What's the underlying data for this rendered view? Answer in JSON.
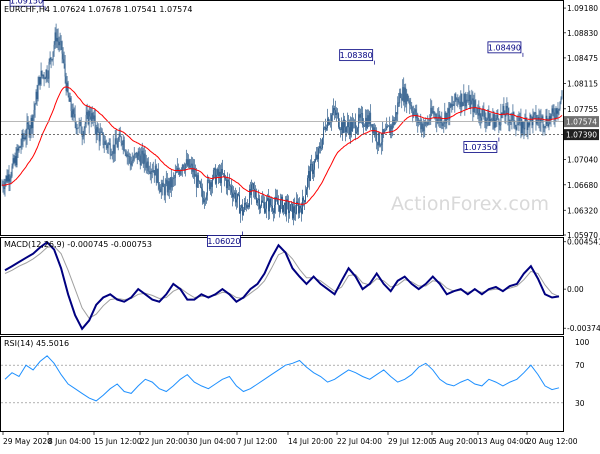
{
  "chart_data": [
    {
      "type": "candlestick",
      "symbol_header": "EURCHF,H4  1.07624 1.07678 1.07541 1.07574",
      "ylim": [
        1.0597,
        1.0928
      ],
      "x_tick_labels": [
        "29 May 2020",
        "8 Jun 04:00",
        "15 Jun 12:00",
        "22 Jun 20:00",
        "30 Jun 04:00",
        "7 Jul 12:00",
        "14 Jul 20:00",
        "22 Jul 04:00",
        "29 Jul 12:00",
        "5 Aug 20:00",
        "13 Aug 04:00",
        "20 Aug 12:00"
      ],
      "y_tick_labels": [
        "1.09180",
        "1.08830",
        "1.08475",
        "1.08115",
        "1.07755",
        "1.07395",
        "1.07040",
        "1.06680",
        "1.06320",
        "1.05970"
      ],
      "anchors": [
        [
          0,
          1.0668
        ],
        [
          5,
          1.069
        ],
        [
          10,
          1.073
        ],
        [
          15,
          1.076
        ],
        [
          19,
          1.082
        ],
        [
          23,
          1.083
        ],
        [
          27,
          1.088
        ],
        [
          30,
          1.0855
        ],
        [
          33,
          1.079
        ],
        [
          36,
          1.076
        ],
        [
          40,
          1.0745
        ],
        [
          44,
          1.077
        ],
        [
          48,
          1.074
        ],
        [
          52,
          1.0725
        ],
        [
          56,
          1.072
        ],
        [
          60,
          1.0735
        ],
        [
          64,
          1.07
        ],
        [
          68,
          1.071
        ],
        [
          72,
          1.07
        ],
        [
          76,
          1.069
        ],
        [
          80,
          1.066
        ],
        [
          85,
          1.067
        ],
        [
          90,
          1.07
        ],
        [
          95,
          1.069
        ],
        [
          100,
          1.065
        ],
        [
          105,
          1.068
        ],
        [
          110,
          1.068
        ],
        [
          115,
          1.066
        ],
        [
          120,
          1.063
        ],
        [
          125,
          1.066
        ],
        [
          130,
          1.064
        ],
        [
          135,
          1.064
        ],
        [
          140,
          1.064
        ],
        [
          145,
          1.063
        ],
        [
          150,
          1.064
        ],
        [
          153,
          1.068
        ],
        [
          158,
          1.071
        ],
        [
          162,
          1.076
        ],
        [
          166,
          1.077
        ],
        [
          170,
          1.075
        ],
        [
          175,
          1.075
        ],
        [
          180,
          1.076
        ],
        [
          184,
          1.076
        ],
        [
          188,
          1.073
        ],
        [
          192,
          1.074
        ],
        [
          196,
          1.076
        ],
        [
          199,
          1.08
        ],
        [
          203,
          1.079
        ],
        [
          207,
          1.076
        ],
        [
          211,
          1.075
        ],
        [
          215,
          1.077
        ],
        [
          219,
          1.076
        ],
        [
          223,
          1.077
        ],
        [
          227,
          1.079
        ],
        [
          231,
          1.079
        ],
        [
          235,
          1.078
        ],
        [
          239,
          1.077
        ],
        [
          243,
          1.076
        ],
        [
          247,
          1.076
        ],
        [
          251,
          1.077
        ],
        [
          255,
          1.076
        ],
        [
          259,
          1.075
        ],
        [
          263,
          1.076
        ],
        [
          267,
          1.076
        ],
        [
          271,
          1.076
        ],
        [
          275,
          1.0765
        ],
        [
          279,
          1.079
        ],
        [
          281,
          1.0815
        ],
        [
          284,
          1.077
        ],
        [
          287,
          1.076
        ],
        [
          290,
          1.0755
        ],
        [
          294,
          1.0757
        ]
      ],
      "price_labels": [
        {
          "text": "1.09150",
          "bar": 43,
          "price": 1.0915
        },
        {
          "text": "1.06020",
          "bar": 240,
          "price": 1.0602
        },
        {
          "text": "1.08380",
          "bar": 372,
          "price": 1.0838
        },
        {
          "text": "1.07350",
          "bar": 496,
          "price": 1.0735
        },
        {
          "text": "1.08490",
          "bar": 520,
          "price": 1.0849
        }
      ],
      "current_price": "1.07574",
      "level_price": "1.07390",
      "ma_color": "#ff0000",
      "candle_color": "#2c5b8a",
      "watermark": "ActionForex.com"
    },
    {
      "type": "line",
      "title": "MACD(12,26,9) -0.000745 -0.000753",
      "y_tick_labels": [
        "0.004541",
        "0.00",
        "-0.003745"
      ],
      "ylim": [
        -0.0043,
        0.0049
      ],
      "series": [
        {
          "values": [
            0.0018,
            0.0022,
            0.0026,
            0.003,
            0.0034,
            0.004,
            0.0045,
            0.0038,
            0.002,
            -0.0005,
            -0.0025,
            -0.0038,
            -0.003,
            -0.0015,
            -0.0008,
            -0.0005,
            -0.001,
            -0.0012,
            -0.0008,
            0.0,
            -0.0005,
            -0.001,
            -0.0012,
            -0.0005,
            0.0005,
            0.0,
            -0.001,
            -0.001,
            -0.0005,
            -0.0008,
            -0.0005,
            0.0,
            -0.0005,
            -0.0012,
            -0.0008,
            0.0,
            0.0005,
            0.0015,
            0.003,
            0.0042,
            0.0035,
            0.002,
            0.0012,
            0.0005,
            0.0012,
            0.0005,
            0.0,
            -0.0005,
            0.0008,
            0.002,
            0.0012,
            0.0,
            0.0005,
            0.0015,
            0.0005,
            -0.0002,
            0.0008,
            0.0012,
            0.0005,
            0.0,
            0.0005,
            0.0012,
            0.0005,
            -0.0005,
            -0.0002,
            0.0,
            -0.0005,
            0.0,
            -0.0005,
            0.0,
            0.0002,
            -0.0002,
            0.0003,
            0.0005,
            0.0015,
            0.0022,
            0.001,
            -0.0005,
            -0.0008,
            -0.0007
          ]
        },
        {
          "values": [
            0.0015,
            0.0018,
            0.0022,
            0.0025,
            0.0029,
            0.0034,
            0.004,
            0.0041,
            0.0034,
            0.0018,
            0.0,
            -0.0018,
            -0.0028,
            -0.0024,
            -0.0016,
            -0.001,
            -0.0009,
            -0.001,
            -0.0009,
            -0.0005,
            -0.0004,
            -0.0006,
            -0.0009,
            -0.0008,
            -0.0002,
            0.0001,
            -0.0004,
            -0.0008,
            -0.0007,
            -0.0007,
            -0.0006,
            -0.0003,
            -0.0004,
            -0.0008,
            -0.0009,
            -0.0004,
            0.0001,
            0.0008,
            0.002,
            0.0033,
            0.0036,
            0.0029,
            0.0019,
            0.0011,
            0.0011,
            0.0008,
            0.0003,
            -0.0002,
            0.0002,
            0.0013,
            0.0014,
            0.0006,
            0.0004,
            0.001,
            0.0008,
            0.0002,
            0.0004,
            0.0009,
            0.0007,
            0.0003,
            0.0003,
            0.0008,
            0.0007,
            0.0001,
            -0.0002,
            -0.0001,
            -0.0003,
            -0.0001,
            -0.0003,
            -0.0001,
            0.0,
            -0.0001,
            0.0001,
            0.0003,
            0.0009,
            0.0017,
            0.0015,
            0.0004,
            -0.0004,
            -0.0007
          ]
        }
      ]
    },
    {
      "type": "line",
      "title": "RSI(14) 45.5016",
      "y_tick_labels": [
        "100",
        "70",
        "30",
        "0"
      ],
      "ylim": [
        0,
        100
      ],
      "levels": [
        70,
        30
      ],
      "series": [
        {
          "values": [
            55,
            62,
            58,
            70,
            65,
            74,
            80,
            72,
            60,
            50,
            45,
            40,
            35,
            32,
            38,
            45,
            50,
            42,
            40,
            48,
            55,
            52,
            45,
            42,
            48,
            55,
            60,
            52,
            48,
            45,
            50,
            55,
            58,
            48,
            42,
            45,
            50,
            55,
            60,
            65,
            70,
            72,
            75,
            68,
            62,
            58,
            52,
            55,
            60,
            65,
            62,
            58,
            55,
            60,
            65,
            58,
            52,
            55,
            60,
            68,
            72,
            65,
            55,
            50,
            48,
            52,
            55,
            50,
            48,
            55,
            52,
            48,
            52,
            55,
            62,
            70,
            60,
            48,
            44,
            46
          ]
        }
      ]
    }
  ]
}
